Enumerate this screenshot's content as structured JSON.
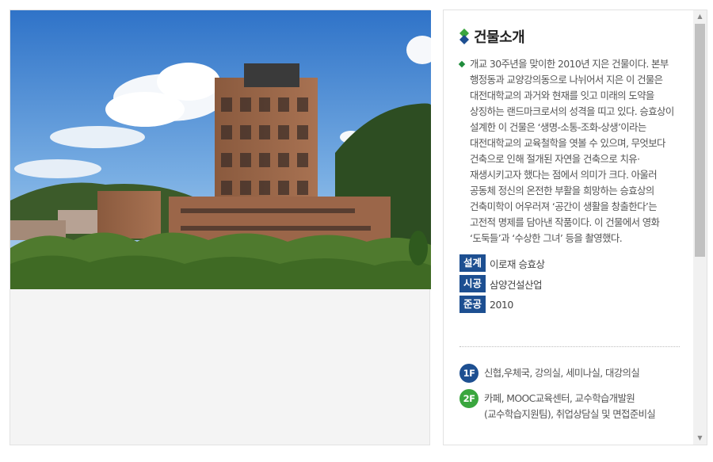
{
  "building": {
    "title": "건물소개",
    "description": "개교 30주년을 맞이한 2010년 지은 건물이다. 본부 행정동과 교양강의동으로 나뉘어서 지은 이 건물은 대전대학교의 과거와 현재를 잇고 미래의 도약을 상징하는 랜드마크로서의 성격을 띠고 있다. 승효상이 설계한 이 건물은 ‘생명-소통-조화-상생’이라는 대전대학교의 교육철학을 엿볼 수 있으며, 무엇보다 건축으로 인해 절개된 자연을 건축으로 치유·재생시키고자 했다는 점에서 의미가 크다. 아울러 공동체 정신의 온전한 부활을 희망하는 승효상의 건축미학이 어우러져 ‘공간이 생활을 창출한다’는 고전적 명제를 담아낸 작품이다. 이 건물에서 영화 ‘도둑들’과 ‘수상한 그녀’ 등을 촬영했다.",
    "meta": [
      {
        "label": "설계",
        "value": "이로재 승효상"
      },
      {
        "label": "시공",
        "value": "삼양건설산업"
      },
      {
        "label": "준공",
        "value": "2010"
      }
    ],
    "floors": [
      {
        "badge": "1F",
        "color": "#1d4f91",
        "text": "신협,우체국, 강의실, 세미나실, 대강의실"
      },
      {
        "badge": "2F",
        "color": "#3aa63e",
        "text": "카페, MOOC교육센터, 교수학습개발원(교수학습지원팀), 취업상담실 및 면접준비실"
      }
    ]
  },
  "colors": {
    "accent_blue": "#1d4f91",
    "accent_green": "#3aa63e",
    "bullet_green": "#1f8c3c"
  },
  "icons": {
    "title_mark": "diamond-icon",
    "bullet": "diamond-bullet-icon",
    "scroll_up": "scroll-up-arrow-icon",
    "scroll_down": "scroll-down-arrow-icon"
  }
}
